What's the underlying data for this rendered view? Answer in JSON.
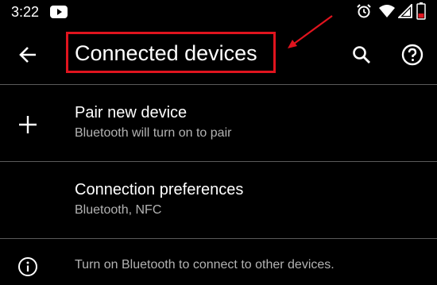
{
  "status_bar": {
    "time": "3:22",
    "icons": [
      "youtube-icon",
      "alarm-icon",
      "wifi-icon",
      "signal-icon",
      "battery-icon"
    ],
    "battery_color": "#e0141e"
  },
  "app_bar": {
    "title": "Connected devices",
    "highlight_color": "#e0141e",
    "icons": [
      "back-arrow-icon",
      "search-icon",
      "help-icon"
    ]
  },
  "items": [
    {
      "title": "Pair new device",
      "subtitle": "Bluetooth will turn on to pair",
      "icon": "plus-icon"
    },
    {
      "title": "Connection preferences",
      "subtitle": "Bluetooth, NFC",
      "icon": ""
    }
  ],
  "footer": {
    "text": "Turn on Bluetooth to connect to other devices.",
    "icon": "info-icon"
  },
  "colors": {
    "background": "#000000",
    "primary_text": "#ffffff",
    "secondary_text": "#b3b3b3",
    "divider": "#5a5a5a"
  }
}
